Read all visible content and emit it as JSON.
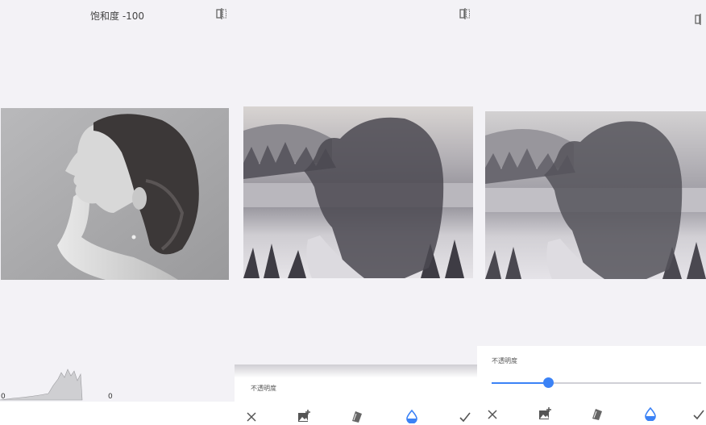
{
  "panel1": {
    "title": "饱和度 -100",
    "histogram": {
      "min_label": "0",
      "max_label": "0"
    }
  },
  "panel2": {
    "opacity_label": "不透明度"
  },
  "panel3": {
    "opacity_label": "不透明度",
    "opacity_slider_fraction": 0.27
  },
  "toolbar": {
    "icons": [
      "close-icon",
      "add-image-icon",
      "blend-mode-icon",
      "opacity-drop-icon",
      "check-icon"
    ],
    "active_icon": "opacity-drop-icon",
    "accent_color": "#3b82f6"
  },
  "colors": {
    "slider_track": "#d0d0d6",
    "slider_active": "#3b82f6"
  }
}
